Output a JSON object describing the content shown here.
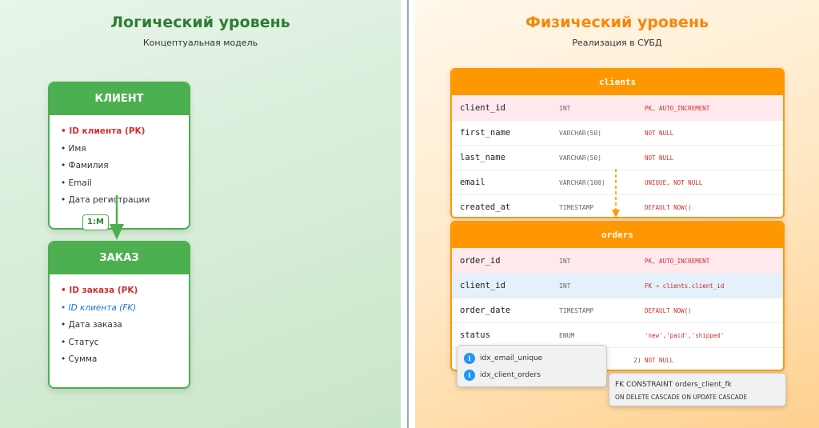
{
  "logical": {
    "title": "Логический уровень",
    "subtitle": "Концептуальная модель",
    "client": {
      "name": "КЛИЕНТ",
      "attributes": [
        {
          "text": "• ID клиента (PK)",
          "kind": "pk"
        },
        {
          "text": "• Имя",
          "kind": "normal"
        },
        {
          "text": "• Фамилия",
          "kind": "normal"
        },
        {
          "text": "• Email",
          "kind": "normal"
        },
        {
          "text": "• Дата регистрации",
          "kind": "normal"
        }
      ]
    },
    "order": {
      "name": "ЗАКАЗ",
      "attributes": [
        {
          "text": "• ID заказа (PK)",
          "kind": "pk"
        },
        {
          "text": "• ID клиента (FK)",
          "kind": "fk"
        },
        {
          "text": "• Дата заказа",
          "kind": "normal"
        },
        {
          "text": "• Статус",
          "kind": "normal"
        },
        {
          "text": "• Сумма",
          "kind": "normal"
        }
      ]
    },
    "relationship": "1:M"
  },
  "physical": {
    "title": "Физический уровень",
    "subtitle": "Реализация в СУБД",
    "clients": {
      "name": "clients",
      "columns": [
        {
          "name": "client_id",
          "type": "INT",
          "constraint": "PK, AUTO_INCREMENT",
          "kind": "pk"
        },
        {
          "name": "first_name",
          "type": "VARCHAR(50)",
          "constraint": "NOT NULL",
          "kind": "normal"
        },
        {
          "name": "last_name",
          "type": "VARCHAR(50)",
          "constraint": "NOT NULL",
          "kind": "normal"
        },
        {
          "name": "email",
          "type": "VARCHAR(100)",
          "constraint": "UNIQUE, NOT NULL",
          "kind": "normal"
        },
        {
          "name": "created_at",
          "type": "TIMESTAMP",
          "constraint": "DEFAULT NOW()",
          "kind": "normal"
        }
      ]
    },
    "orders": {
      "name": "orders",
      "columns": [
        {
          "name": "order_id",
          "type": "INT",
          "constraint": "PK, AUTO_INCREMENT",
          "kind": "pk"
        },
        {
          "name": "client_id",
          "type": "INT",
          "constraint": "FK → clients.client_id",
          "kind": "fk"
        },
        {
          "name": "order_date",
          "type": "TIMESTAMP",
          "constraint": "DEFAULT NOW()",
          "kind": "normal"
        },
        {
          "name": "status",
          "type": "ENUM",
          "constraint": "'new','paid','shipped'",
          "kind": "normal"
        },
        {
          "name": "",
          "type": "2)",
          "constraint": "NOT NULL",
          "kind": "normal"
        }
      ]
    },
    "indexes": [
      {
        "icon": "i",
        "name": "idx_email_unique"
      },
      {
        "icon": "i",
        "name": "idx_client_orders"
      }
    ],
    "fk_constraint": {
      "title": "FK CONSTRAINT orders_client_fk",
      "detail": "ON DELETE CASCADE ON UPDATE CASCADE"
    }
  }
}
